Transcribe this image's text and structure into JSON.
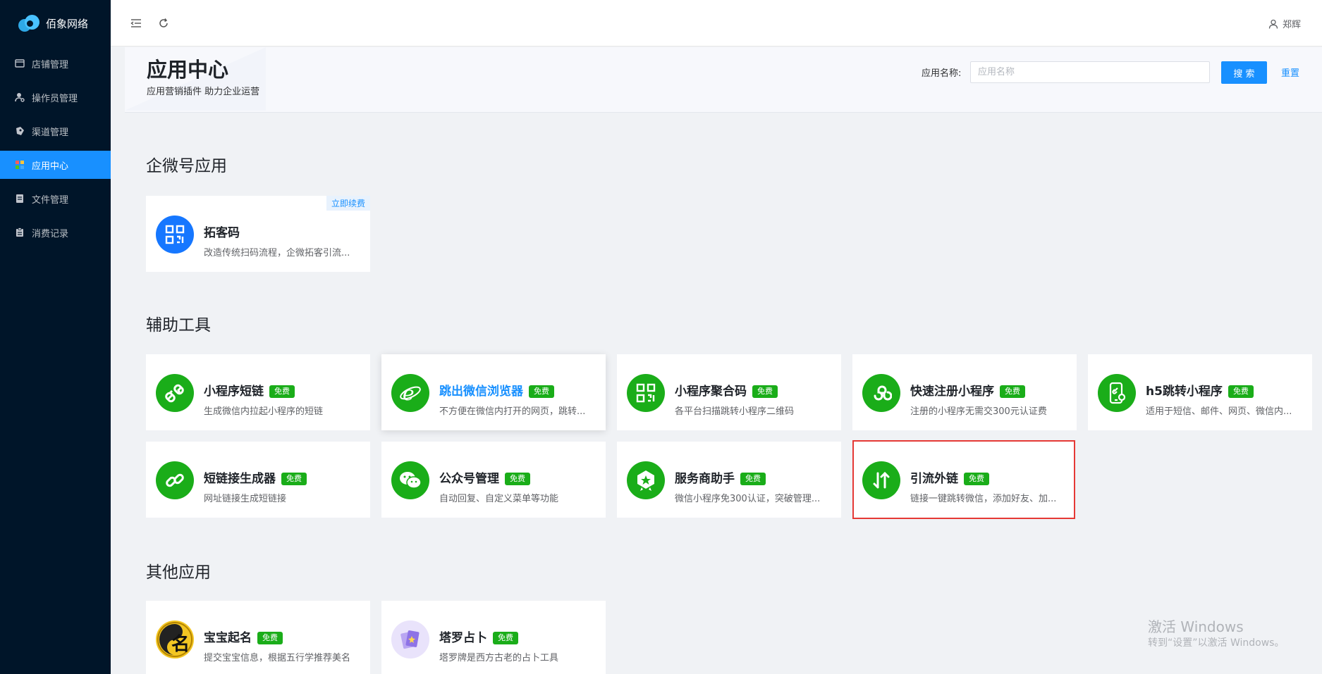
{
  "brand": {
    "name": "佰象网络"
  },
  "sidebar": {
    "items": [
      {
        "label": "店铺管理",
        "icon": "store-icon"
      },
      {
        "label": "操作员管理",
        "icon": "user-gear-icon"
      },
      {
        "label": "渠道管理",
        "icon": "channel-icon"
      },
      {
        "label": "应用中心",
        "icon": "apps-icon",
        "active": true
      },
      {
        "label": "文件管理",
        "icon": "file-icon"
      },
      {
        "label": "消费记录",
        "icon": "clipboard-icon"
      }
    ]
  },
  "header": {
    "user_name": "郑辉"
  },
  "page": {
    "title": "应用中心",
    "subtitle": "应用营销插件 助力企业运营",
    "search_label": "应用名称:",
    "search_placeholder": "应用名称",
    "search_value": "",
    "search_button": "搜 索",
    "reset_link": "重置"
  },
  "sections": [
    {
      "title": "企微号应用",
      "cards": [
        {
          "name": "拓客码",
          "desc": "改造传统扫码流程，企微拓客引流...",
          "corner": "立即续费",
          "icon": "qrcode-icon"
        }
      ]
    },
    {
      "title": "辅助工具",
      "cards": [
        {
          "name": "小程序短链",
          "badge": "免费",
          "desc": "生成微信内拉起小程序的短链",
          "icon": "link-icon"
        },
        {
          "name": "跳出微信浏览器",
          "badge": "免费",
          "desc": "不方便在微信内打开的网页，跳转...",
          "icon": "ie-browser-icon"
        },
        {
          "name": "小程序聚合码",
          "badge": "免费",
          "desc": "各平台扫描跳转小程序二维码",
          "icon": "qrcode-icon"
        },
        {
          "name": "快速注册小程序",
          "badge": "免费",
          "desc": "注册的小程序无需交300元认证费",
          "icon": "miniprogram-icon"
        },
        {
          "name": "h5跳转小程序",
          "badge": "免费",
          "desc": "适用于短信、邮件、网页、微信内...",
          "icon": "phone-link-icon"
        },
        {
          "name": "短链接生成器",
          "badge": "免费",
          "desc": "网址链接生成短链接",
          "icon": "link-icon"
        },
        {
          "name": "公众号管理",
          "badge": "免费",
          "desc": "自动回复、自定义菜单等功能",
          "icon": "wechat-icon"
        },
        {
          "name": "服务商助手",
          "badge": "免费",
          "desc": "微信小程序免300认证，突破管理...",
          "icon": "award-icon"
        },
        {
          "name": "引流外链",
          "badge": "免费",
          "desc": "链接一键跳转微信，添加好友、加...",
          "icon": "up-down-arrows-icon"
        }
      ]
    },
    {
      "title": "其他应用",
      "cards": [
        {
          "name": "宝宝起名",
          "badge": "免费",
          "desc": "提交宝宝信息，根据五行学推荐美名",
          "icon": "yin-yang-name-icon"
        },
        {
          "name": "塔罗占卜",
          "badge": "免费",
          "desc": "塔罗牌是西方古老的占卜工具",
          "icon": "tarot-icon"
        }
      ]
    }
  ],
  "watermark": {
    "line1": "激活 Windows",
    "line2": "转到“设置”以激活 Windows。"
  },
  "colors": {
    "sidebar_bg": "#001529",
    "primary": "#1890ff",
    "badge_green": "#1aad19",
    "highlight_border": "#e53935"
  }
}
